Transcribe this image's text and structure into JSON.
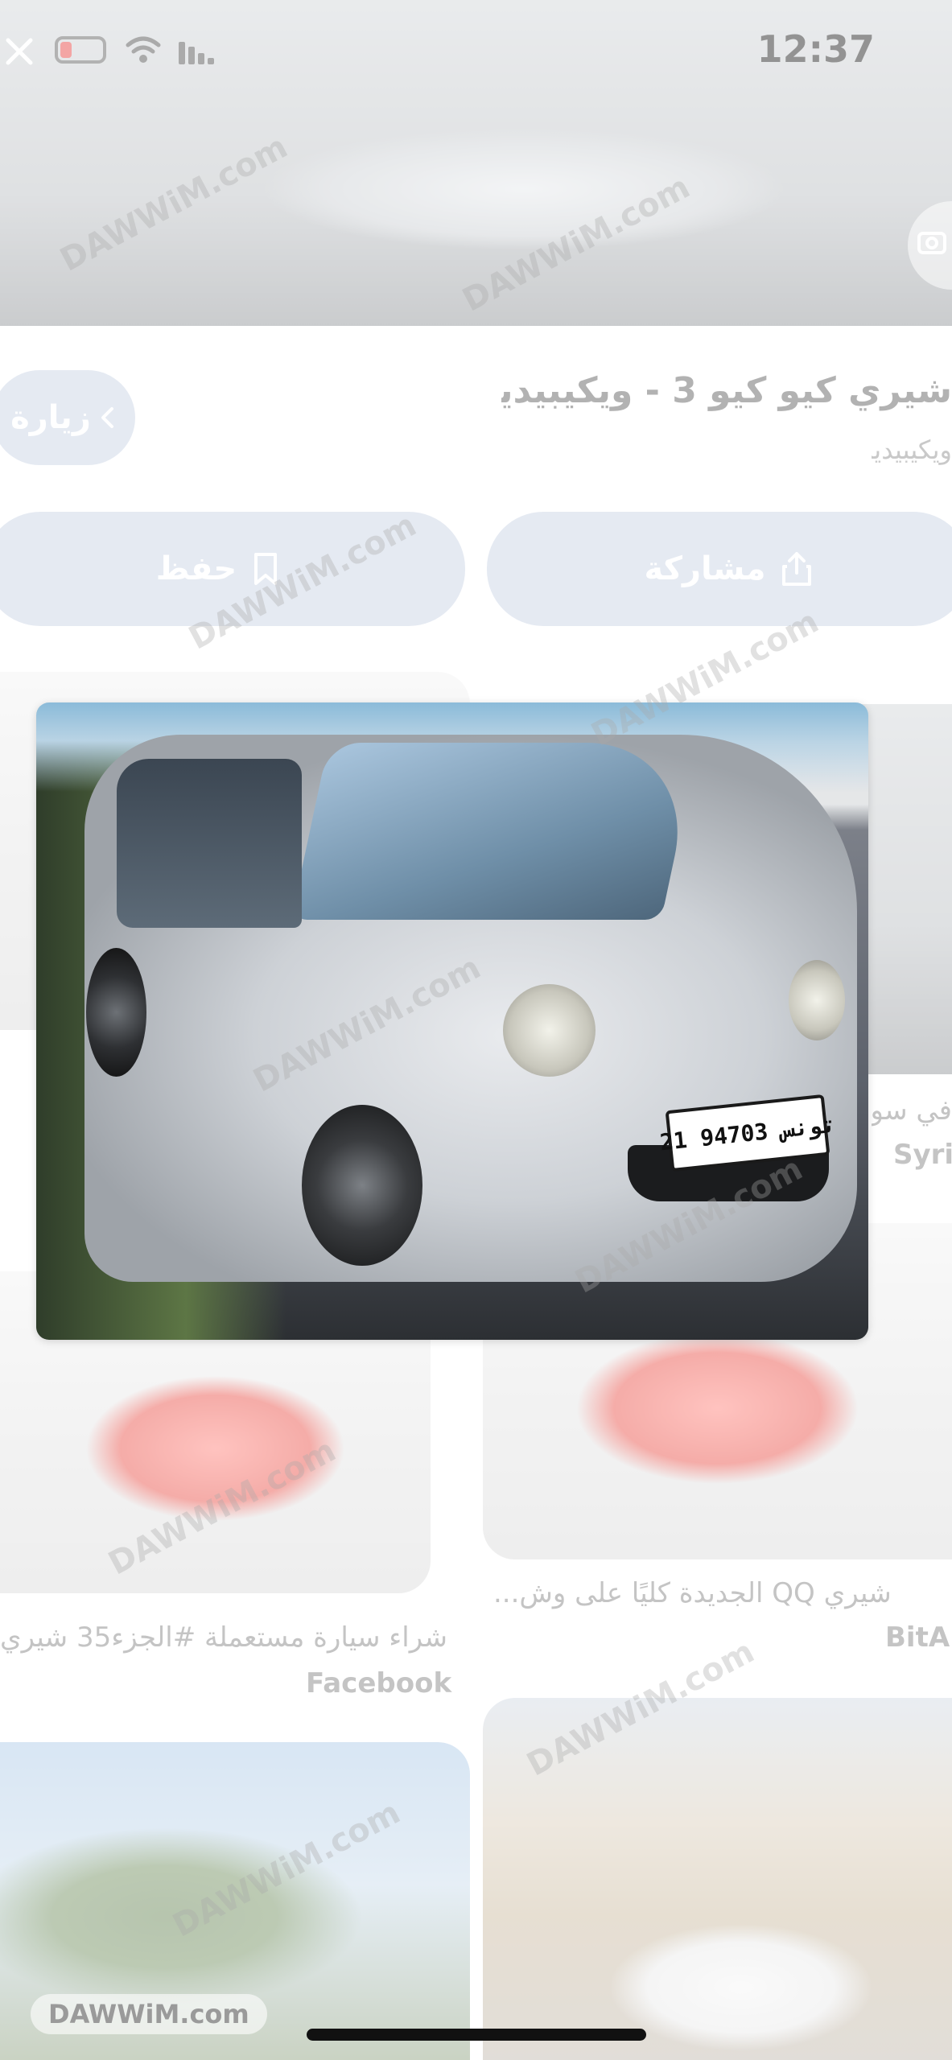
{
  "status_bar": {
    "time": "12:37"
  },
  "result": {
    "title": "شيري كيو كيو 3 - ويكيبيديا",
    "source": "ويكيبيديا",
    "visit_label": "زيارة"
  },
  "actions": {
    "share_label": "مشاركة",
    "save_label": "حفظ"
  },
  "grid": {
    "item_top_right": {
      "caption": "في سوريا",
      "source": "Syria C"
    },
    "item_mid_right": {
      "caption": "شيري QQ الجديدة كليًا على وش...",
      "source": "BitA"
    },
    "item_mid_left": {
      "caption": "شراء سيارة مستعملة #الجزء35 شيري",
      "source": "Facebook"
    }
  },
  "photo": {
    "plate": "21 تونس 94703"
  },
  "watermark": "DAWWiM.com",
  "colors": {
    "pill": "#c5d0e3",
    "accent_text": "#ffffff"
  }
}
